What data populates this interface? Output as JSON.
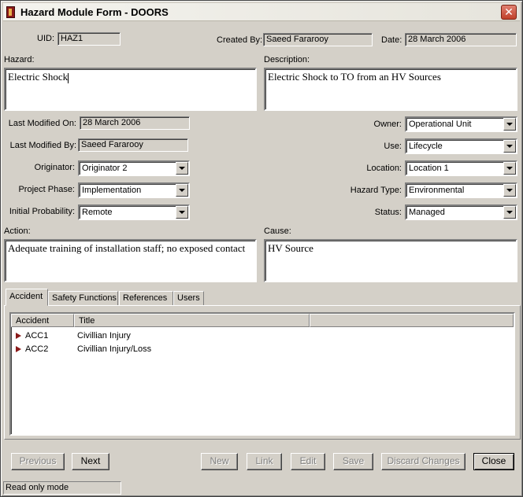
{
  "window": {
    "title": "Hazard Module Form - DOORS",
    "close_glyph": "✕"
  },
  "fields": {
    "uid": {
      "label": "UID:",
      "value": "HAZ1"
    },
    "created_by": {
      "label": "Created By:",
      "value": "Saeed Fararooy"
    },
    "date": {
      "label": "Date:",
      "value": "28 March 2006"
    },
    "hazard": {
      "label": "Hazard:",
      "value": "Electric Shock"
    },
    "description": {
      "label": "Description:",
      "value": "Electric Shock to TO from an HV Sources"
    },
    "last_modified_on": {
      "label": "Last Modified On:",
      "value": "28 March 2006"
    },
    "last_modified_by": {
      "label": "Last Modified By:",
      "value": "Saeed Fararooy"
    },
    "originator": {
      "label": "Originator:",
      "value": "Originator 2"
    },
    "project_phase": {
      "label": "Project Phase:",
      "value": "Implementation"
    },
    "initial_probability": {
      "label": "Initial Probability:",
      "value": "Remote"
    },
    "owner": {
      "label": "Owner:",
      "value": "Operational Unit"
    },
    "use": {
      "label": "Use:",
      "value": "Lifecycle"
    },
    "location": {
      "label": "Location:",
      "value": "Location 1"
    },
    "hazard_type": {
      "label": "Hazard Type:",
      "value": "Environmental"
    },
    "status": {
      "label": "Status:",
      "value": "Managed"
    },
    "action": {
      "label": "Action:",
      "value": "Adequate training of installation staff; no exposed contact"
    },
    "cause": {
      "label": "Cause:",
      "value": "HV Source"
    }
  },
  "tabs": [
    {
      "label": "Accident",
      "active": true
    },
    {
      "label": "Safety Functions",
      "active": false
    },
    {
      "label": "References",
      "active": false
    },
    {
      "label": "Users",
      "active": false
    }
  ],
  "accident_table": {
    "columns": [
      "Accident",
      "Title",
      ""
    ],
    "rows": [
      {
        "id": "ACC1",
        "title": "Civillian Injury"
      },
      {
        "id": "ACC2",
        "title": "Civillian Injury/Loss"
      }
    ]
  },
  "buttons": {
    "previous": {
      "label": "Previous",
      "enabled": false
    },
    "next": {
      "label": "Next",
      "enabled": true
    },
    "new": {
      "label": "New",
      "enabled": false
    },
    "link": {
      "label": "Link",
      "enabled": false
    },
    "edit": {
      "label": "Edit",
      "enabled": false
    },
    "save": {
      "label": "Save",
      "enabled": false
    },
    "discard": {
      "label": "Discard Changes",
      "enabled": false
    },
    "close": {
      "label": "Close",
      "enabled": true
    }
  },
  "status_bar": {
    "text": "Read only mode"
  },
  "colors": {
    "face": "#d4d0c8",
    "marker": "#8b1a1a"
  }
}
